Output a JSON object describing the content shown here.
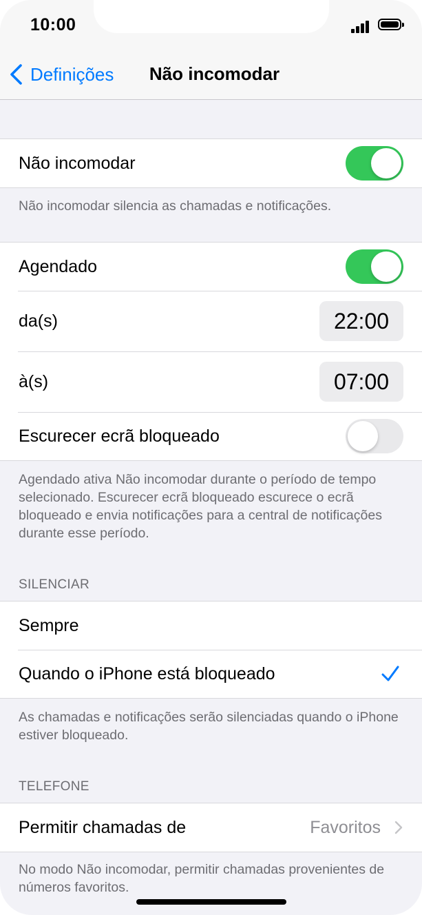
{
  "status_bar": {
    "time": "10:00"
  },
  "nav": {
    "back_label": "Definições",
    "title": "Não incomodar"
  },
  "dnd": {
    "label": "Não incomodar",
    "enabled": true
  },
  "dnd_footer": "Não incomodar silencia as chamadas e notificações.",
  "schedule": {
    "scheduled_label": "Agendado",
    "scheduled_enabled": true,
    "from_label": "da(s)",
    "from_time": "22:00",
    "to_label": "à(s)",
    "to_time": "07:00",
    "dim_label": "Escurecer ecrã bloqueado",
    "dim_enabled": false,
    "footer": "Agendado ativa Não incomodar durante o período de tempo selecionado. Escurecer ecrã bloqueado escurece o ecrã bloqueado e envia notificações para a central de notificações durante esse período."
  },
  "silence": {
    "header": "SILENCIAR",
    "option_always": "Sempre",
    "option_locked": "Quando o iPhone está bloqueado",
    "selected": "option_locked",
    "footer": "As chamadas e notificações serão silenciadas quando o iPhone estiver bloqueado."
  },
  "phone": {
    "header": "TELEFONE",
    "allow_calls_label": "Permitir chamadas de",
    "allow_calls_value": "Favoritos",
    "footer": "No modo Não incomodar, permitir chamadas provenientes de números favoritos."
  },
  "colors": {
    "accent": "#007aff",
    "toggle_on": "#34c759",
    "toggle_off": "#e9e9eb"
  }
}
